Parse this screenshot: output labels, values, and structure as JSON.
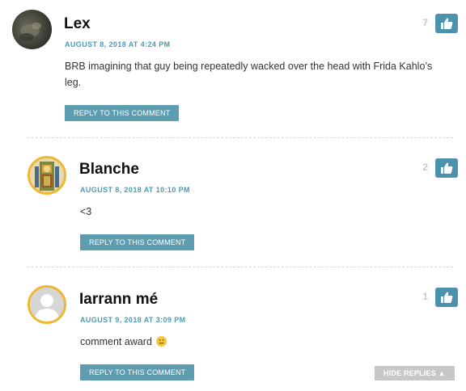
{
  "comments": [
    {
      "author": "Lex",
      "date": "AUGUST 8, 2018 AT 4:24 PM",
      "body": "BRB imagining that guy being repeatedly wacked over the head with Frida Kahlo’s leg.",
      "likes": "7",
      "reply_label": "REPLY TO THIS COMMENT"
    },
    {
      "author": "Blanche",
      "date": "AUGUST 8, 2018 AT 10:10 PM",
      "body": "<3",
      "likes": "2",
      "reply_label": "REPLY TO THIS COMMENT"
    },
    {
      "author": "Iarrann mé",
      "date": "AUGUST 9, 2018 AT 3:09 PM",
      "body": "comment award",
      "emoji": "slightly-smiling-face",
      "likes": "1",
      "reply_label": "REPLY TO THIS COMMENT",
      "hide_replies_label": "HIDE REPLIES ▲"
    }
  ],
  "colors": {
    "accent": "#4c9ab5",
    "button": "#5e9cb0",
    "like_button": "#4c91ad",
    "avatar_ring": "#f0b733",
    "hide_replies": "#c7c7c7"
  },
  "icons": {
    "like": "thumbs-up-icon",
    "default_avatar": "person-silhouette-icon"
  }
}
